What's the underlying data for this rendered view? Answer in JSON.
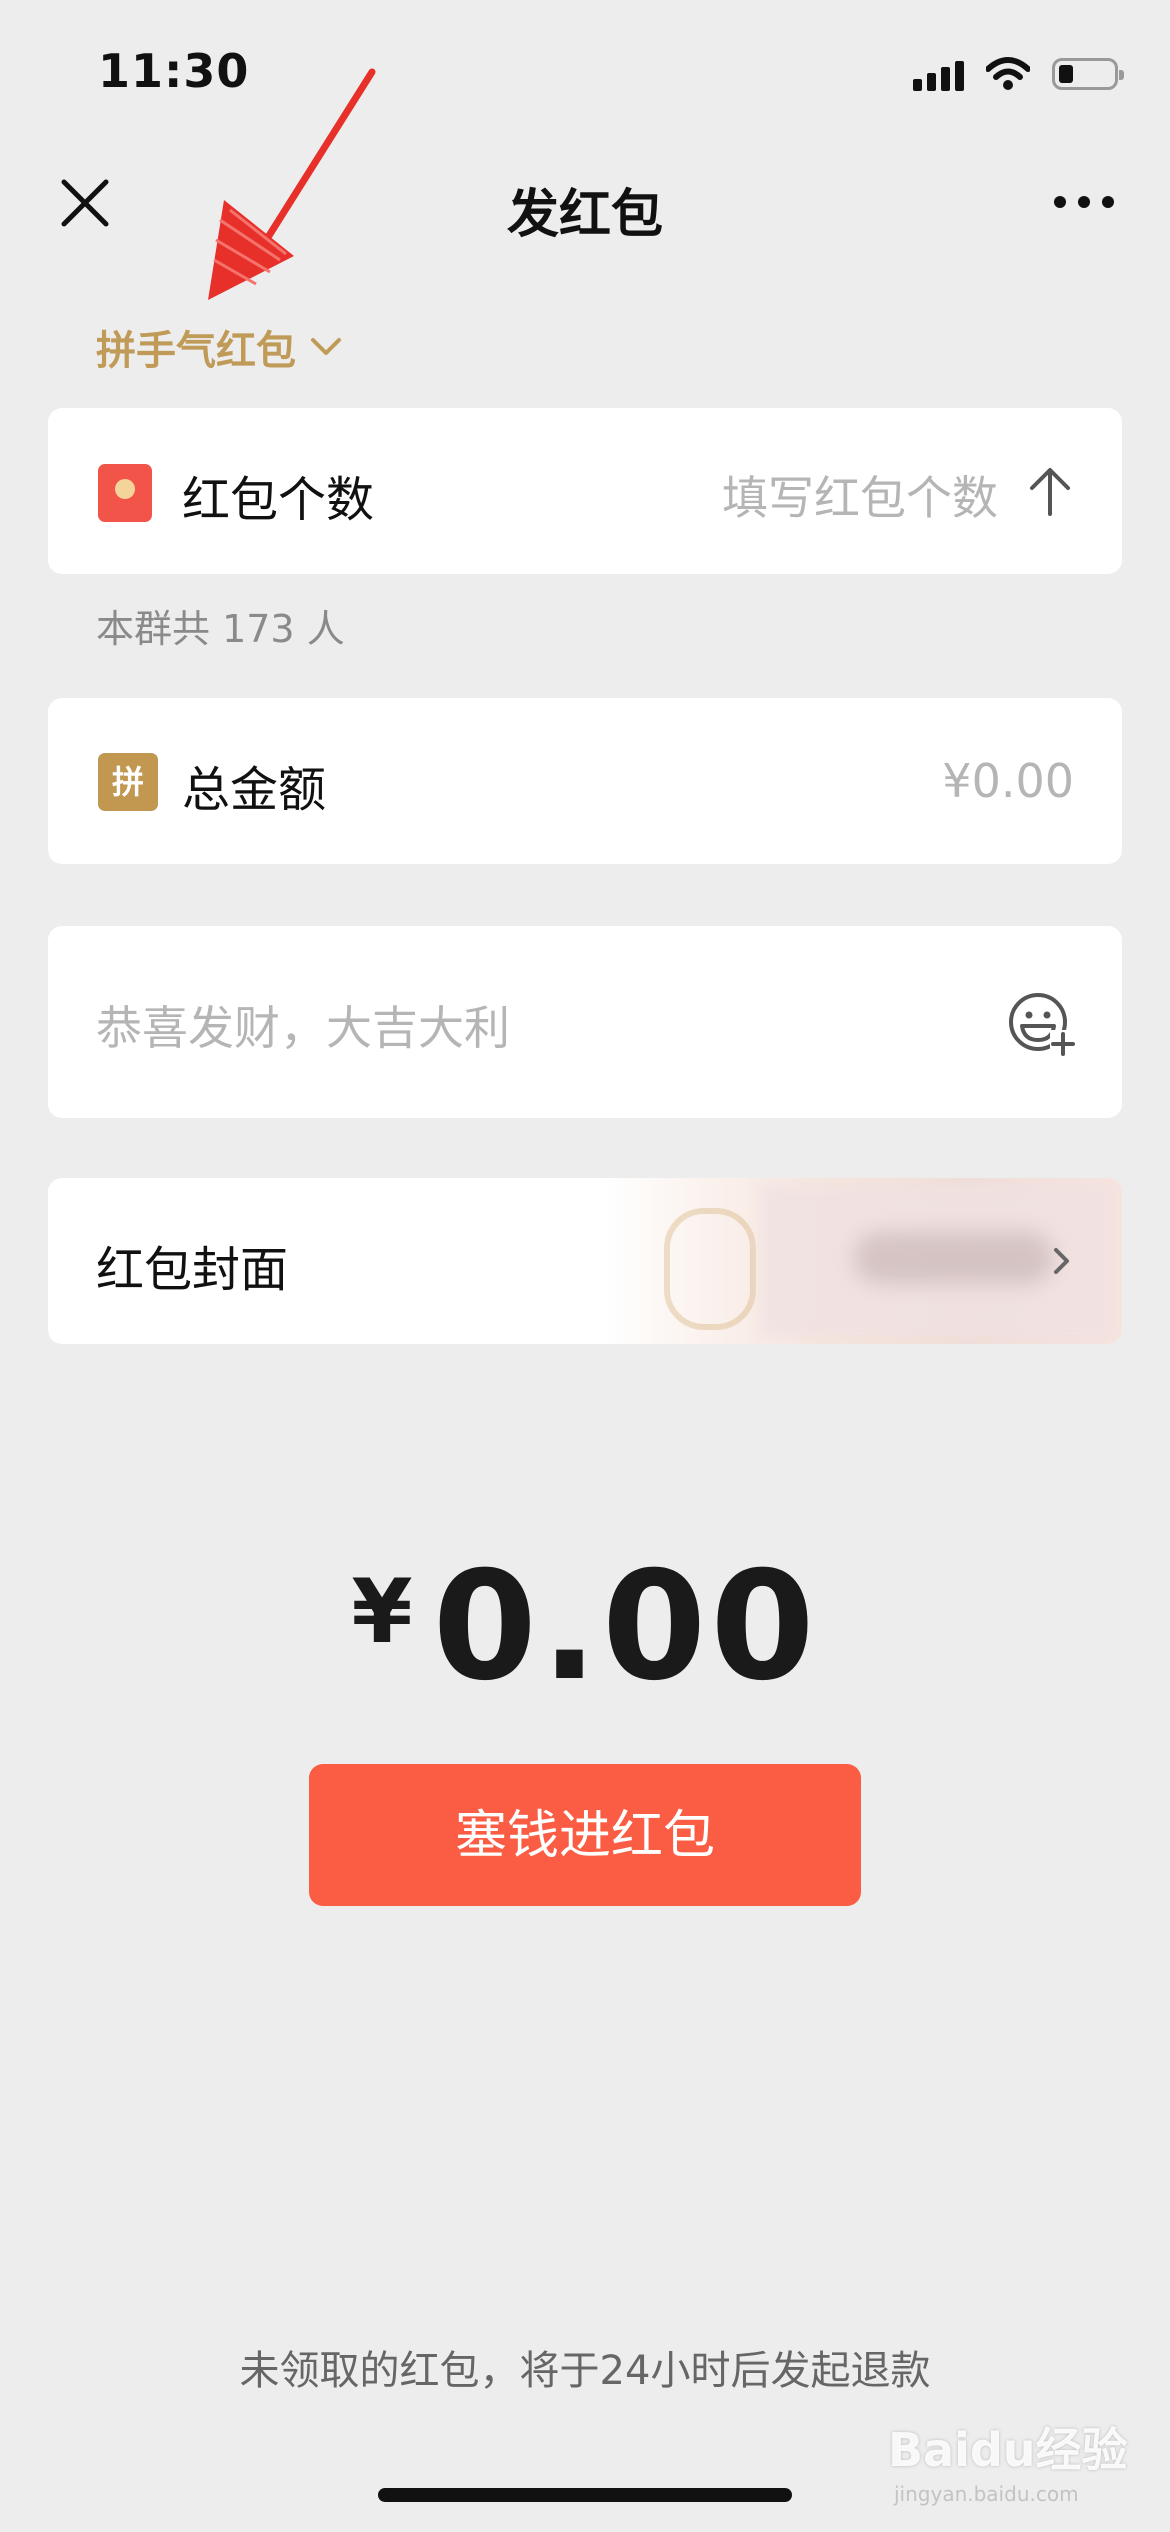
{
  "status_bar": {
    "time": "11:30",
    "icons": [
      "signal-icon",
      "wifi-icon",
      "battery-icon"
    ]
  },
  "nav": {
    "title": "发红包",
    "close_icon": "close-icon",
    "more_icon": "more-icon"
  },
  "packet_type": {
    "label": "拼手气红包",
    "icon": "chevron-down-icon"
  },
  "count_row": {
    "label": "红包个数",
    "placeholder": "填写红包个数",
    "icon": "red-packet-icon",
    "trailing_icon": "up-arrow-icon"
  },
  "member_info": "本群共 173 人",
  "amount_row": {
    "badge": "拼",
    "label": "总金额",
    "placeholder": "¥0.00"
  },
  "greeting": {
    "placeholder": "恭喜发财，大吉大利",
    "icon": "emoji-add-icon"
  },
  "cover_row": {
    "label": "红包封面",
    "icon": "chevron-right-icon"
  },
  "total": {
    "currency": "¥",
    "amount": "0.00"
  },
  "submit_button": "塞钱进红包",
  "refund_note": "未领取的红包，将于24小时后发起退款",
  "watermark": {
    "brand": "Baidu经验",
    "url": "jingyan.baidu.com"
  },
  "colors": {
    "accent_gold": "#c09a57",
    "button_red": "#fa5d43",
    "annotation_red": "#e8302a",
    "background": "#ededed"
  }
}
